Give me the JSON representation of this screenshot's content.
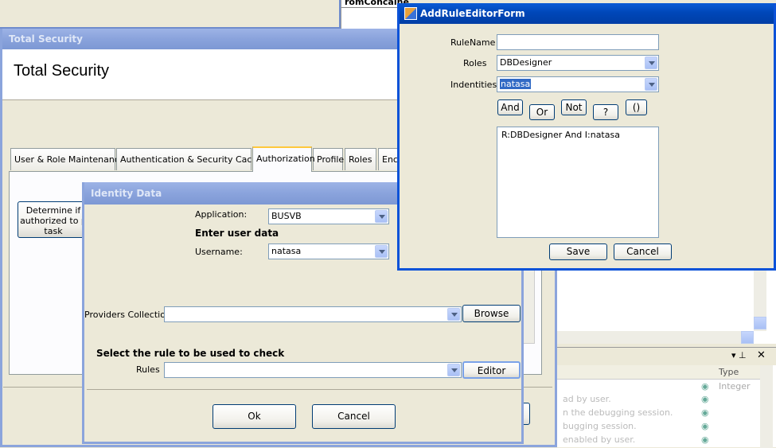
{
  "bg_window": {
    "visible_text": "romConcaine"
  },
  "total_security": {
    "title": "Total Security",
    "header": "Total Security",
    "tabs": [
      "User & Role Maintenance",
      "Authentication & Security Caching",
      "Authorization",
      "Profile",
      "Roles",
      "Enc"
    ],
    "active_tab": "Authorization",
    "task_button": {
      "line1": "Determine if",
      "line2": "authorized to p",
      "line3": "task"
    }
  },
  "identity": {
    "title": "Identity Data",
    "application_label": "Application:",
    "application_value": "BUSVB",
    "enter_user_data": "Enter user data",
    "username_label": "Username:",
    "username_value": "natasa",
    "providers_label": "Providers Collection",
    "providers_value": "",
    "browse_label": "Browse",
    "select_rule_text": "Select the rule to be used to check",
    "rules_label": "Rules",
    "rules_value": "",
    "editor_label": "Editor",
    "ok_label": "Ok",
    "cancel_label": "Cancel"
  },
  "rule_editor": {
    "title": "AddRuleEditorForm",
    "rulename_label": "RuleName",
    "rulename_value": "",
    "roles_label": "Roles",
    "roles_value": "DBDesigner",
    "identities_label": "Indentities",
    "identities_value": "natasa",
    "ops": {
      "and": "And",
      "or": "Or",
      "not": "Not",
      "question": "?",
      "parens": "()"
    },
    "expression": "R:DBDesigner And  I:natasa",
    "save_label": "Save",
    "cancel_label": "Cancel"
  },
  "props_panel": {
    "type_header": "Type",
    "type_value": "Integer",
    "rows": [
      "ad by user.",
      "n the debugging session.",
      "bugging session.",
      "enabled by user."
    ]
  }
}
